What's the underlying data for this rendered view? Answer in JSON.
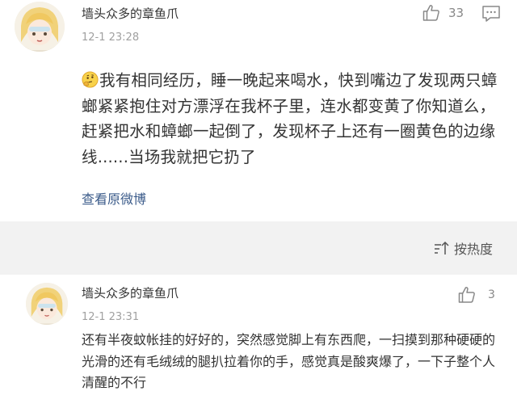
{
  "main_comment": {
    "username": "墙头众多的章鱼爪",
    "timestamp": "12-1 23:28",
    "likes": "33",
    "text": "我有相同经历，睡一晚起来喝水，快到嘴边了发现两只蟑螂紧紧抱住对方漂浮在我杯子里，连水都变黄了你知道么，赶紧把水和蟑螂一起倒了，发现杯子上还有一圈黄色的边缘线......当场我就把它扔了",
    "emoji": "thinking-face",
    "view_original": "查看原微博"
  },
  "sort": {
    "label": "按热度"
  },
  "reply": {
    "username": "墙头众多的章鱼爪",
    "timestamp": "12-1 23:31",
    "likes": "3",
    "text": "还有半夜蚊帐挂的好好的，突然感觉脚上有东西爬，一扫摸到那种硬硬的光滑的还有毛绒绒的腿扒拉着你的手，感觉真是酸爽爆了，一下子整个人清醒的不行"
  },
  "colors": {
    "link": "#3b5b8a",
    "timestamp": "#a0a0a0",
    "sort_bar_bg": "#f2f2f2",
    "text": "#333333",
    "icon": "#888888"
  },
  "icons": [
    "avatar",
    "thumbs-up-icon",
    "comment-icon",
    "sort-icon",
    "thinking-face-emoji"
  ]
}
